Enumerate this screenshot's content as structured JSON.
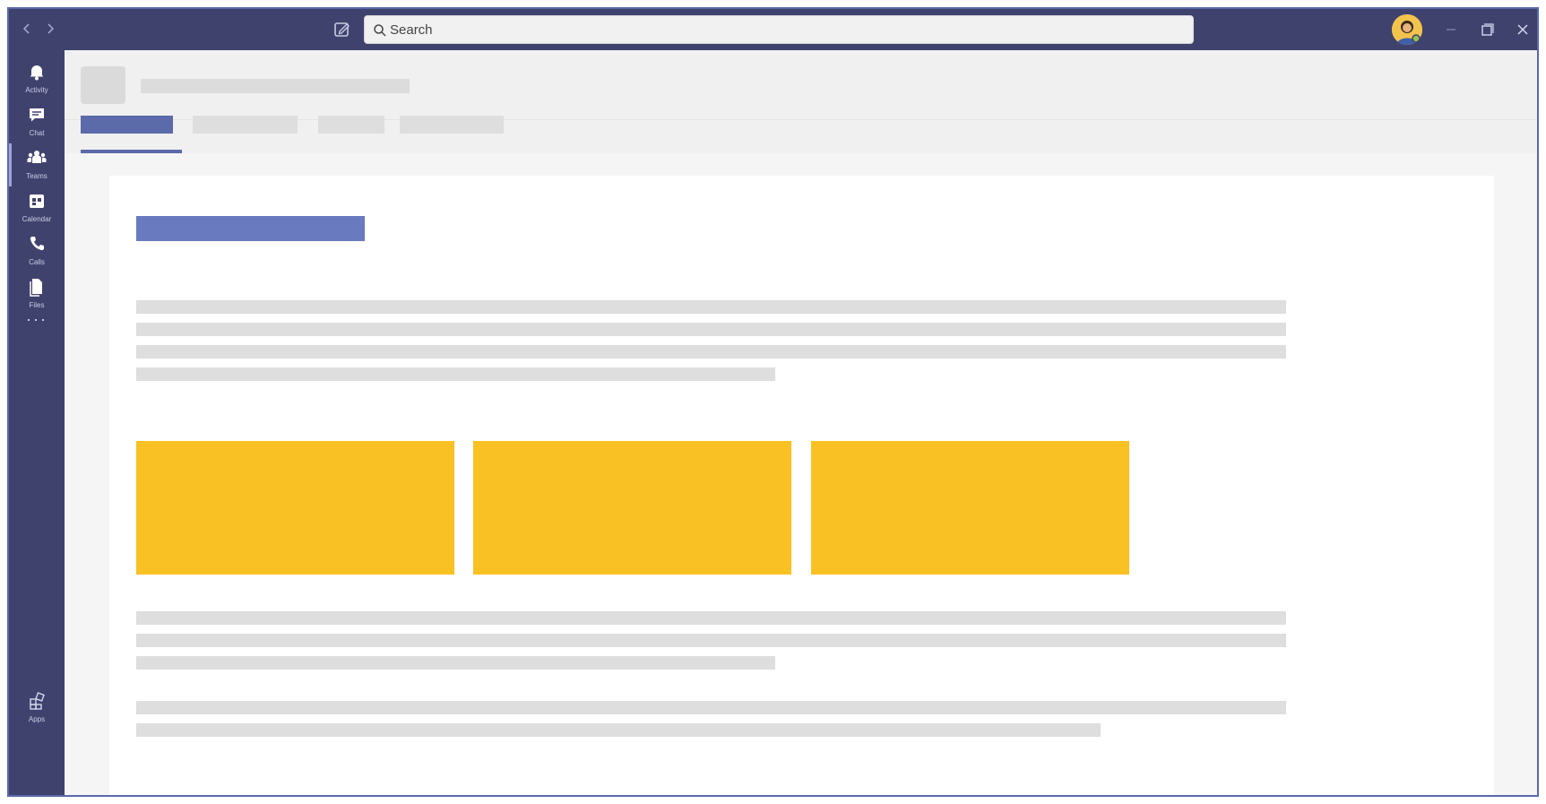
{
  "titlebar": {
    "back_icon": "chevron-left-icon",
    "forward_icon": "chevron-right-icon",
    "compose_icon": "compose-icon",
    "search": {
      "placeholder": "Search",
      "icon": "search-icon"
    },
    "avatar_icon": "user-avatar",
    "window_controls": [
      "minimize-icon",
      "maximize-icon",
      "close-icon"
    ]
  },
  "rail": {
    "items": [
      {
        "label": "Activity",
        "icon": "bell-icon"
      },
      {
        "label": "Chat",
        "icon": "chat-icon"
      },
      {
        "label": "Teams",
        "icon": "teams-icon",
        "active": true
      },
      {
        "label": "Calendar",
        "icon": "calendar-icon"
      },
      {
        "label": "Calls",
        "icon": "phone-icon"
      },
      {
        "label": "Files",
        "icon": "file-icon"
      }
    ],
    "more_label": "···",
    "bottom_item": {
      "label": "Apps",
      "icon": "apps-icon"
    }
  },
  "colors": {
    "rail": "#40426e",
    "accent": "#5b6aa8",
    "tile": "#f9c123",
    "placeholder": "#dedede"
  }
}
